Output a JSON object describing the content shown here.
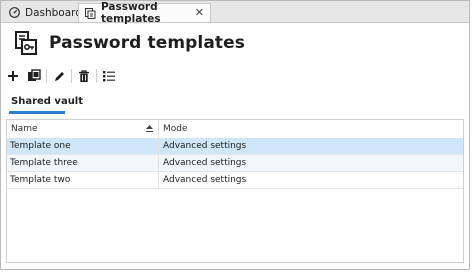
{
  "tabs": [
    {
      "label": "Dashboard",
      "icon": "dashboard-icon"
    },
    {
      "label": "Password templates",
      "icon": "password-templates-icon",
      "close": "✕"
    }
  ],
  "header": {
    "title": "Password templates",
    "icon": "password-templates-icon"
  },
  "toolbar": {
    "icons": [
      "add-icon",
      "duplicate-icon",
      "edit-icon",
      "delete-icon",
      "checklist-icon"
    ]
  },
  "section_tab": "Shared vault",
  "table": {
    "columns": [
      "Name",
      "Mode"
    ],
    "rows": [
      {
        "name": "Template one",
        "mode": "Advanced settings",
        "selected": true
      },
      {
        "name": "Template three",
        "mode": "Advanced settings",
        "selected": false
      },
      {
        "name": "Template two",
        "mode": "Advanced settings",
        "selected": false
      }
    ]
  },
  "colors": {
    "accent": "#2a7fd0",
    "selected_row": "#cfe6fb"
  }
}
